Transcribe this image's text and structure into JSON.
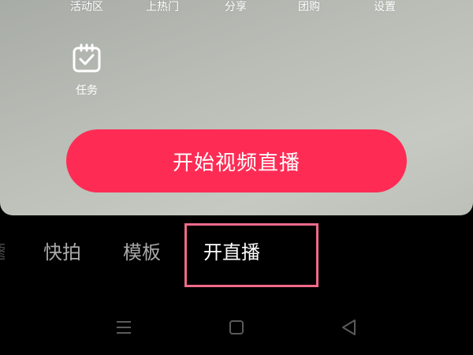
{
  "toolbar": {
    "items": [
      {
        "label": "活动区"
      },
      {
        "label": "上热门"
      },
      {
        "label": "分享"
      },
      {
        "label": "团购"
      },
      {
        "label": "设置"
      }
    ],
    "task": {
      "label": "任务",
      "icon": "task-checklist-icon"
    }
  },
  "start_button": {
    "label": "开始视频直播"
  },
  "mode_tabs": {
    "partial": "图",
    "items": [
      {
        "label": "快拍"
      },
      {
        "label": "模板"
      },
      {
        "label": "开直播",
        "active": true
      }
    ]
  },
  "nav_bar": {
    "icons": [
      "menu-icon",
      "home-icon",
      "back-icon"
    ]
  },
  "colors": {
    "accent": "#fe2c55",
    "highlight_border": "#f06a8a",
    "background": "#000000"
  }
}
